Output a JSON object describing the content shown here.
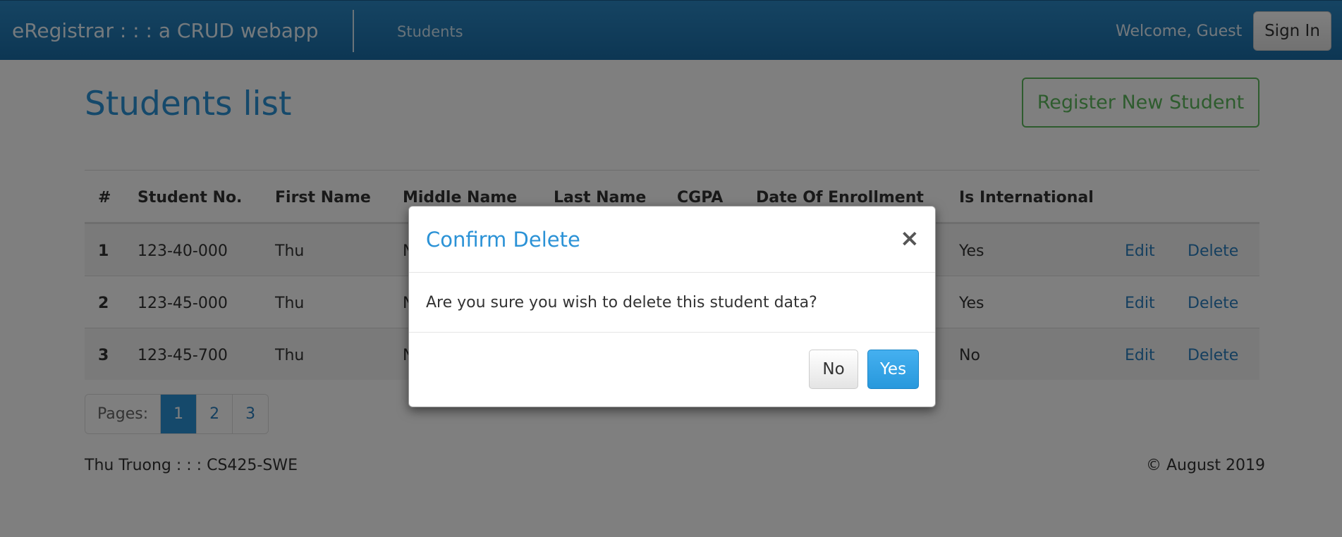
{
  "navbar": {
    "brand": "eRegistrar : : : a CRUD webapp",
    "links": [
      "Students"
    ],
    "welcome": "Welcome, Guest",
    "signin": "Sign In"
  },
  "page": {
    "title": "Students list",
    "register_button": "Register New Student"
  },
  "table": {
    "headers": [
      "#",
      "Student No.",
      "First Name",
      "Middle Name",
      "Last Name",
      "CGPA",
      "Date Of Enrollment",
      "Is International"
    ],
    "rows": [
      {
        "num": "1",
        "student_no": "123-40-000",
        "first_name": "Thu",
        "middle_initial": "N",
        "is_international": "Yes",
        "edit": "Edit",
        "delete": "Delete"
      },
      {
        "num": "2",
        "student_no": "123-45-000",
        "first_name": "Thu",
        "middle_initial": "N",
        "is_international": "Yes",
        "edit": "Edit",
        "delete": "Delete"
      },
      {
        "num": "3",
        "student_no": "123-45-700",
        "first_name": "Thu",
        "middle_initial": "N",
        "is_international": "No",
        "edit": "Edit",
        "delete": "Delete"
      }
    ]
  },
  "pagination": {
    "label": "Pages:",
    "pages": [
      "1",
      "2",
      "3"
    ],
    "active": "1"
  },
  "footer": {
    "left": "Thu Truong : : : CS425-SWE",
    "right": "© August 2019"
  },
  "modal": {
    "title": "Confirm Delete",
    "close": "×",
    "body": "Are you sure you wish to delete this student data?",
    "no": "No",
    "yes": "Yes"
  },
  "colors": {
    "navbar": "#1a6da7",
    "accent": "#2b92d6",
    "success": "#5cb85c",
    "overlay": "rgba(0,0,0,0.5)"
  }
}
